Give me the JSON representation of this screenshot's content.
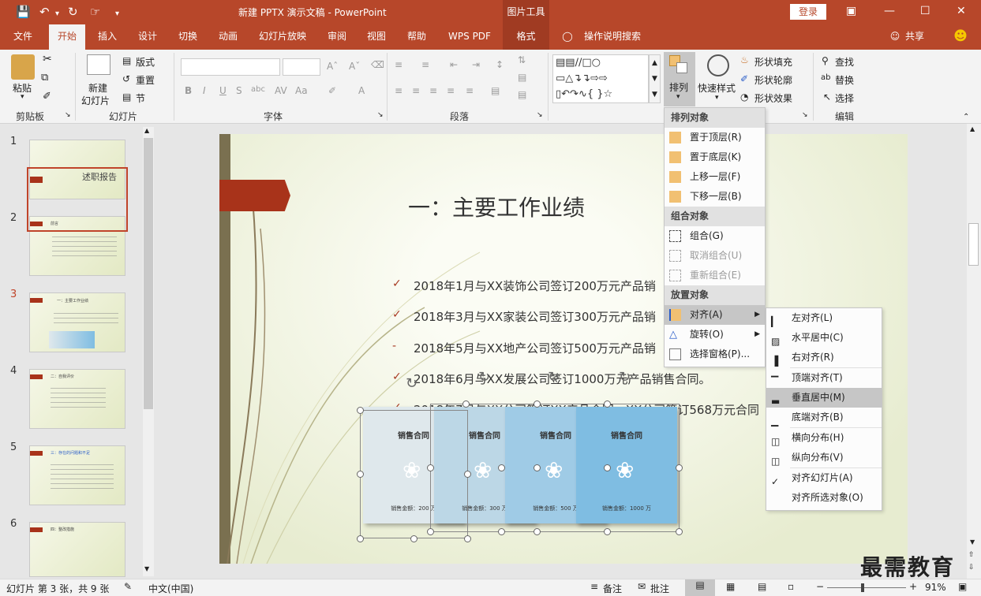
{
  "titlebar": {
    "title": "新建 PPTX 演示文稿  -  PowerPoint",
    "context_tab": "图片工具",
    "login": "登录"
  },
  "menubar": {
    "tabs": [
      "文件",
      "开始",
      "插入",
      "设计",
      "切换",
      "动画",
      "幻灯片放映",
      "审阅",
      "视图",
      "帮助",
      "WPS PDF",
      "格式"
    ],
    "search": "操作说明搜索",
    "share": "共享"
  },
  "ribbon": {
    "clipboard": {
      "paste": "粘贴",
      "label": "剪贴板"
    },
    "slides": {
      "new_slide_1": "新建",
      "new_slide_2": "幻灯片",
      "layout": "版式",
      "reset": "重置",
      "section": "节",
      "label": "幻灯片"
    },
    "font": {
      "label": "字体"
    },
    "paragraph": {
      "label": "段落"
    },
    "drawing": {
      "arrange": "排列",
      "quick_style": "快速样式",
      "fill": "形状填充",
      "outline": "形状轮廓",
      "effect": "形状效果"
    },
    "editing": {
      "find": "查找",
      "replace": "替换",
      "select": "选择",
      "label": "编辑"
    }
  },
  "thumbnails": [
    {
      "num": "1",
      "title": "述职报告"
    },
    {
      "num": "2",
      "title": "前言"
    },
    {
      "num": "3",
      "title": "一：主要工作业绩"
    },
    {
      "num": "4",
      "title": "二：自我评价"
    },
    {
      "num": "5",
      "title": "三：存在的问题和不足"
    },
    {
      "num": "6",
      "title": "四：整改措施"
    }
  ],
  "slide": {
    "title": "一：主要工作业绩",
    "bullets": [
      "2018年1月与XX装饰公司签订200万元产品销",
      "2018年3月与XX家装公司签订300万元产品销",
      "2018年5月与XX地产公司签订500万元产品销",
      "2018年6月与XX发展公司签订1000万元产品销售合同。",
      "2018年7月与XX公司签订XX产品合同，XX公司签订568万元合同"
    ],
    "bullet_marks": [
      "✓",
      "✓",
      "-",
      "✓",
      "✓"
    ],
    "cards": [
      {
        "title": "销售合同",
        "amount": "销售金额：200 万",
        "color": "#dfe8ec"
      },
      {
        "title": "销售合同",
        "amount": "销售金额：300 万",
        "color": "#bcd7e6"
      },
      {
        "title": "销售合同",
        "amount": "销售金额：500 万",
        "color": "#9fcbe6"
      },
      {
        "title": "销售合同",
        "amount": "销售金额：1000 万",
        "color": "#7fbde2"
      }
    ]
  },
  "arrange_menu": {
    "header_order": "排列对象",
    "order": [
      "置于顶层(R)",
      "置于底层(K)",
      "上移一层(F)",
      "下移一层(B)"
    ],
    "header_group": "组合对象",
    "group": [
      "组合(G)",
      "取消组合(U)",
      "重新组合(E)"
    ],
    "header_place": "放置对象",
    "place": [
      "对齐(A)",
      "旋转(O)",
      "选择窗格(P)..."
    ]
  },
  "align_menu": {
    "items": [
      "左对齐(L)",
      "水平居中(C)",
      "右对齐(R)",
      "顶端对齐(T)",
      "垂直居中(M)",
      "底端对齐(B)",
      "横向分布(H)",
      "纵向分布(V)",
      "对齐幻灯片(A)",
      "对齐所选对象(O)"
    ]
  },
  "status": {
    "slide_info": "幻灯片 第 3 张，共 9 张",
    "language": "中文(中国)",
    "notes": "备注",
    "comments": "批注",
    "zoom": "91%"
  },
  "watermark": "最需教育",
  "colors": {
    "accent": "#b7472a",
    "context": "#a03b22"
  }
}
